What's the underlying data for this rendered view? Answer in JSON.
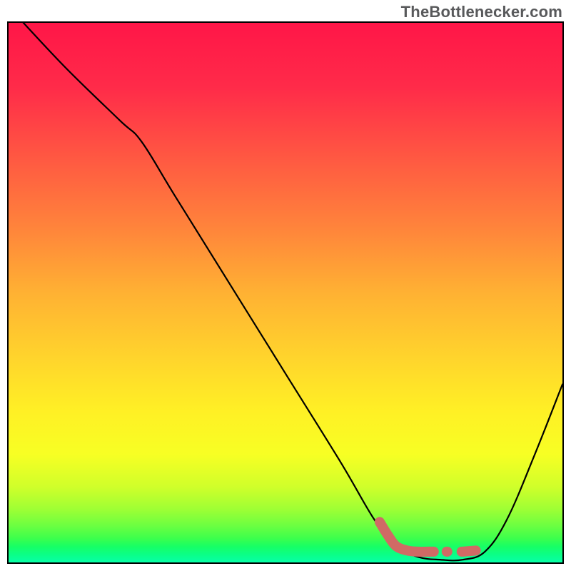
{
  "watermark": "TheBottlenecker.com",
  "colors": {
    "frame": "#000000",
    "curve": "#000000",
    "marker": "#d06a65",
    "gradient_stops": [
      {
        "offset": 0.0,
        "color": "#ff1648"
      },
      {
        "offset": 0.12,
        "color": "#ff2b49"
      },
      {
        "offset": 0.25,
        "color": "#ff5842"
      },
      {
        "offset": 0.38,
        "color": "#ff843b"
      },
      {
        "offset": 0.5,
        "color": "#ffb133"
      },
      {
        "offset": 0.62,
        "color": "#ffd42c"
      },
      {
        "offset": 0.72,
        "color": "#fff025"
      },
      {
        "offset": 0.8,
        "color": "#f7ff24"
      },
      {
        "offset": 0.86,
        "color": "#d0ff2a"
      },
      {
        "offset": 0.9,
        "color": "#a0ff34"
      },
      {
        "offset": 0.93,
        "color": "#6fff40"
      },
      {
        "offset": 0.955,
        "color": "#3dff4c"
      },
      {
        "offset": 0.97,
        "color": "#18ff64"
      },
      {
        "offset": 0.985,
        "color": "#0bff86"
      },
      {
        "offset": 1.0,
        "color": "#07ffa8"
      }
    ]
  },
  "chart_data": {
    "type": "line",
    "title": "",
    "xlabel": "",
    "ylabel": "",
    "xlim": [
      0,
      100
    ],
    "ylim": [
      0,
      100
    ],
    "x": [
      0,
      10,
      20,
      24,
      30,
      40,
      50,
      60,
      66,
      70,
      74,
      78,
      82,
      86,
      90,
      95,
      100
    ],
    "series": [
      {
        "name": "bottleneck-curve",
        "values": [
          103,
          92,
          82,
          78,
          68,
          51.5,
          35,
          18.5,
          8,
          3,
          1,
          0.5,
          0.5,
          2,
          8,
          20,
          33
        ]
      }
    ],
    "markers": {
      "name": "optimal-range",
      "points": [
        {
          "x": 67,
          "y": 7.5
        },
        {
          "x": 68.5,
          "y": 5.0
        },
        {
          "x": 70,
          "y": 3.0
        },
        {
          "x": 72,
          "y": 2.2
        },
        {
          "x": 74,
          "y": 2.0
        },
        {
          "x": 76,
          "y": 2.0
        },
        {
          "x": 78,
          "y": 2.0
        },
        {
          "x": 82,
          "y": 2.0
        },
        {
          "x": 85.5,
          "y": 2.3
        }
      ]
    }
  }
}
